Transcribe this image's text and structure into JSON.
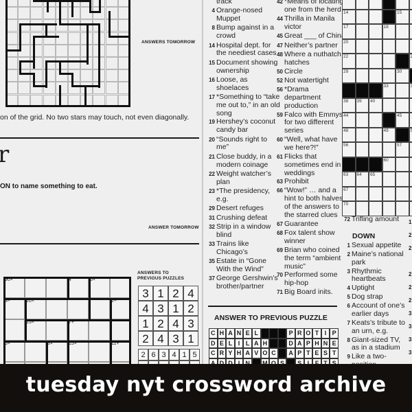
{
  "star_battle": {
    "instruction_fragment": "on of the grid. No two stars may touch, not even diagonally.",
    "answers_label": "ANSWERS TOMORROW"
  },
  "word_puzzle": {
    "title_fragment": "r",
    "instruction_fragment": "ON to name something to eat.",
    "answer_label": "ANSWER TOMORROW"
  },
  "kenken": {
    "cages": [
      {
        "label": "90×"
      },
      {
        "label": "4"
      },
      {
        "label": "6×"
      },
      {
        "label": "3÷"
      },
      {
        "label": "20×"
      },
      {
        "label": "2÷"
      },
      {
        "label": "15×"
      },
      {
        "label": "7+"
      },
      {
        "label": "6×"
      },
      {
        "label": "8×"
      },
      {
        "label": "15×"
      },
      {
        "label": "11+"
      }
    ],
    "answers_label_line1": "ANSWERS TO",
    "answers_label_line2": "PREVIOUS PUZZLES",
    "answer_4x4": [
      [
        "3",
        "1",
        "2",
        "4"
      ],
      [
        "4",
        "3",
        "1",
        "2"
      ],
      [
        "1",
        "2",
        "4",
        "3"
      ],
      [
        "2",
        "4",
        "3",
        "1"
      ]
    ],
    "answer_6x6_first_row": [
      "2",
      "6",
      "3",
      "4",
      "1",
      "5"
    ]
  },
  "across_clues_col1": [
    {
      "num": "",
      "text": "track"
    },
    {
      "num": "4",
      "text": "Orange-nosed Muppet"
    },
    {
      "num": "8",
      "text": "Bump against in a crowd"
    },
    {
      "num": "14",
      "text": "Hospital dept. for the neediest cases"
    },
    {
      "num": "15",
      "text": "Document showing ownership"
    },
    {
      "num": "16",
      "text": "Loose, as shoelaces"
    },
    {
      "num": "17",
      "text": "*Something to “take me out to,” in an old song"
    },
    {
      "num": "19",
      "text": "Hershey’s coconut candy bar"
    },
    {
      "num": "20",
      "text": "“Sounds right to me”"
    },
    {
      "num": "21",
      "text": "Close buddy, in a modern coinage"
    },
    {
      "num": "22",
      "text": "Weight watcher’s plan"
    },
    {
      "num": "23",
      "text": "*The presidency, e.g."
    },
    {
      "num": "29",
      "text": "Desert refuges"
    },
    {
      "num": "31",
      "text": "Crushing defeat"
    },
    {
      "num": "32",
      "text": "Strip in a window blind"
    },
    {
      "num": "33",
      "text": "Trains like Chicago’s"
    },
    {
      "num": "35",
      "text": "Estate in “Gone With the Wind”"
    },
    {
      "num": "37",
      "text": "George Gershwin’s brother/partner"
    }
  ],
  "across_clues_col2": [
    {
      "num": "42",
      "text": "*Means of locating one from the herd"
    },
    {
      "num": "44",
      "text": "Thrilla in Manila victor"
    },
    {
      "num": "45",
      "text": "Great ___ of China"
    },
    {
      "num": "47",
      "text": "Neither’s partner"
    },
    {
      "num": "48",
      "text": "Where a nuthatch hatches"
    },
    {
      "num": "50",
      "text": "Circle"
    },
    {
      "num": "52",
      "text": "Not watertight"
    },
    {
      "num": "56",
      "text": "*Drama department production"
    },
    {
      "num": "59",
      "text": "Falco with Emmys for two different series"
    },
    {
      "num": "60",
      "text": "“Well, what have we here?!”"
    },
    {
      "num": "61",
      "text": "Flicks that sometimes end in weddings"
    },
    {
      "num": "63",
      "text": "Prohibit"
    },
    {
      "num": "66",
      "text": "“Wow!” … and a hint to both halves of the answers to the starred clues"
    },
    {
      "num": "67",
      "text": "Guarantee"
    },
    {
      "num": "68",
      "text": "Fox talent show winner"
    },
    {
      "num": "69",
      "text": "Brian who coined the term “ambient music”"
    },
    {
      "num": "70",
      "text": "Performed some hip-hop"
    },
    {
      "num": "71",
      "text": "Big Board inits."
    }
  ],
  "across_clues_col3": [
    {
      "num": "72",
      "text": "Trifling amount"
    }
  ],
  "down_heading": "DOWN",
  "down_clues": [
    {
      "num": "1",
      "text": "Sexual appetite"
    },
    {
      "num": "2",
      "text": "Maine’s national park"
    },
    {
      "num": "3",
      "text": "Rhythmic heartbeats"
    },
    {
      "num": "4",
      "text": "Uptight"
    },
    {
      "num": "5",
      "text": "Dog strap"
    },
    {
      "num": "6",
      "text": "Account of one’s earlier days"
    },
    {
      "num": "7",
      "text": "Keats’s tribute to an urn, e.g."
    },
    {
      "num": "8",
      "text": "Giant-sized TV, as in a stadium"
    },
    {
      "num": "9",
      "text": "Like a two-position"
    }
  ],
  "crossword_grid_numbers": [
    "14",
    "15",
    "17",
    "18",
    "20",
    "22",
    "29",
    "30",
    "33",
    "38",
    "39",
    "40",
    "44",
    "45",
    "48",
    "49",
    "56",
    "57",
    "60",
    "63",
    "64",
    "65",
    "67",
    "70"
  ],
  "previous_answer": {
    "heading": "ANSWER TO PREVIOUS PUZZLE",
    "rows": [
      "CHANEL##PROTIP",
      "DELILAH#DAPHNE",
      "CRYHAVOC#APTEST",
      "ADDIN#MOS#SIFTS"
    ]
  },
  "banner": {
    "text": "tuesday nyt crossword archive",
    "background": "#120f0d",
    "color": "#ffffff"
  }
}
